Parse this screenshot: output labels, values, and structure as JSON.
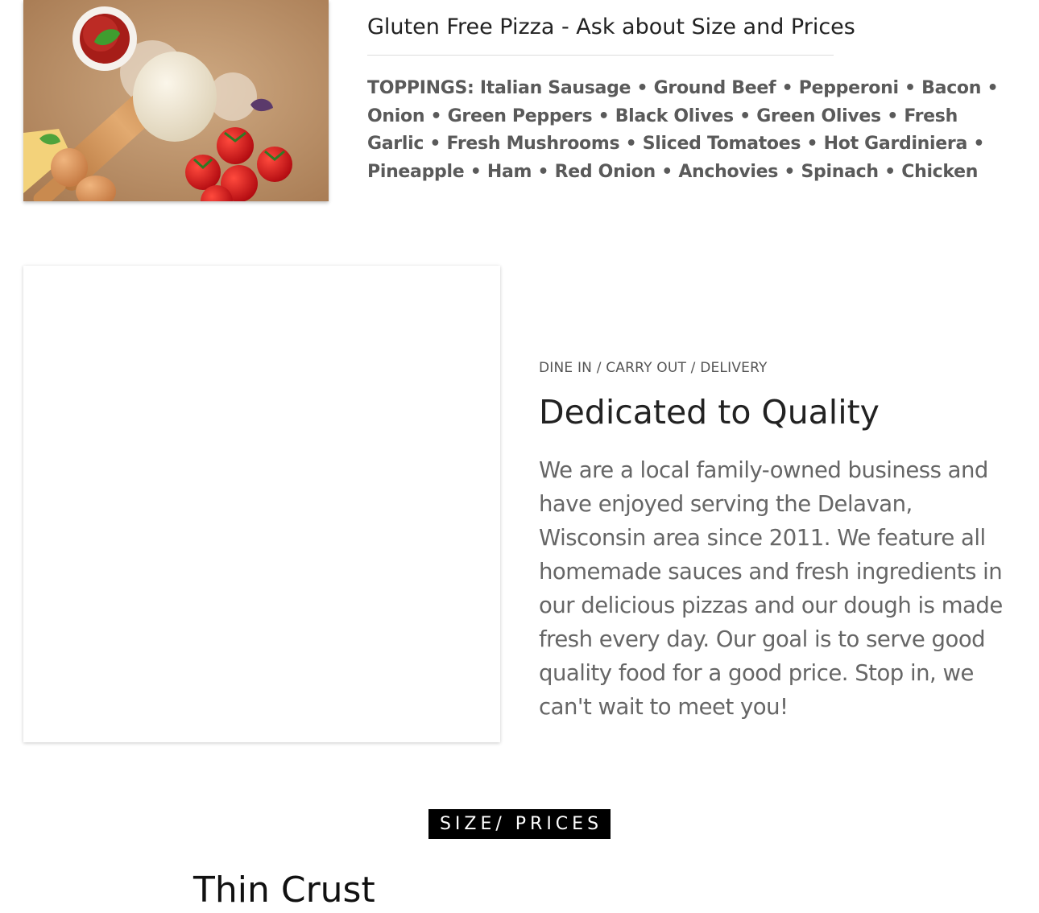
{
  "gluten_free": {
    "title": "Gluten Free Pizza - Ask about Size and Prices",
    "toppings": "TOPPINGS: Italian Sausage • Ground Beef • Pepperoni • Bacon • Onion • Green Peppers • Black Olives • Green Olives • Fresh Garlic • Fresh Mushrooms • Sliced Tomatoes • Hot Gardiniera • Pineapple • Ham • Red Onion • Anchovies • Spinach • Chicken"
  },
  "about": {
    "eyebrow": "DINE IN / CARRY OUT / DELIVERY",
    "heading": "Dedicated to Quality",
    "body": "We are a local family-owned business and have enjoyed serving the Delavan, Wisconsin area since 2011. We feature all homemade sauces and fresh ingredients in our delicious pizzas and our dough is made fresh every day. Our goal is to serve good quality food for a good price.  Stop in, we can't wait to meet you!"
  },
  "prices": {
    "label": "SIZE/ PRICES",
    "crust_heading": "Thin Crust"
  },
  "colors": {
    "paper": "#c39a72",
    "sauce": "#b3261e",
    "tomato": "#d4141a",
    "dough": "#eee6d4",
    "wood": "#d49a62"
  }
}
